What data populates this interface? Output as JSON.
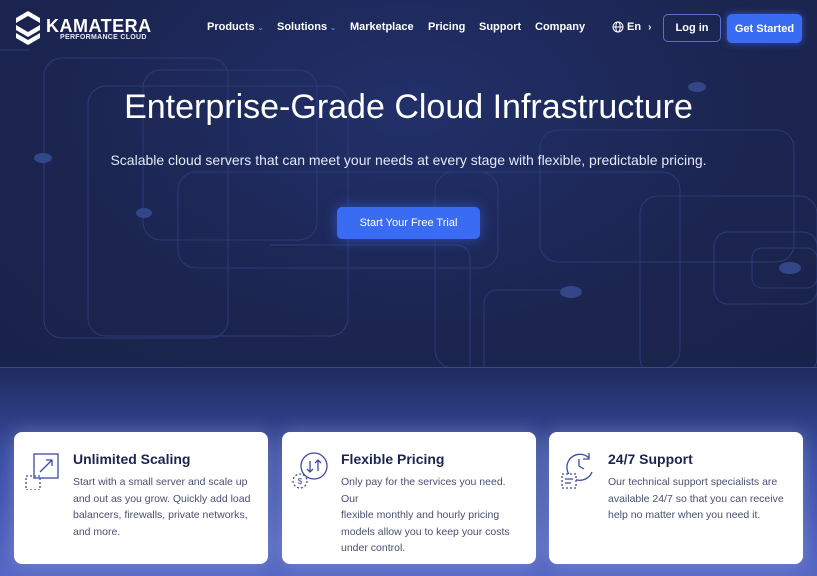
{
  "header": {
    "logo": {
      "name": "KAMATERA",
      "tagline": "PERFORMANCE CLOUD"
    },
    "nav": [
      {
        "label": "Products",
        "has_dropdown": true
      },
      {
        "label": "Solutions",
        "has_dropdown": true
      },
      {
        "label": "Marketplace",
        "has_dropdown": false
      },
      {
        "label": "Pricing",
        "has_dropdown": false
      },
      {
        "label": "Support",
        "has_dropdown": false
      },
      {
        "label": "Company",
        "has_dropdown": false
      }
    ],
    "language": {
      "label": "En",
      "icon": "globe-icon"
    },
    "login_label": "Log in",
    "get_started_label": "Get Started"
  },
  "hero": {
    "title": "Enterprise-Grade Cloud Infrastructure",
    "subtitle": "Scalable cloud servers that can meet your needs at every stage with flexible, predictable pricing.",
    "cta_label": "Start Your Free Trial"
  },
  "features": [
    {
      "icon": "scaling-icon",
      "title": "Unlimited Scaling",
      "lines": [
        "Start with a small server and scale up",
        "and out as you grow. Quickly add load",
        "balancers, firewalls, private networks,",
        "and more."
      ]
    },
    {
      "icon": "pricing-icon",
      "title": "Flexible Pricing",
      "lines": [
        "Only pay for the services you need. Our",
        "flexible monthly and hourly pricing",
        "models allow you to keep your costs",
        "under control."
      ]
    },
    {
      "icon": "support-icon",
      "title": "24/7 Support",
      "lines": [
        "Our technical support specialists are",
        "available 24/7 so that you can receive",
        "help no matter when you need it."
      ]
    }
  ],
  "colors": {
    "background": "#1c2852",
    "accent": "#3a6cf3",
    "card_title": "#1b2550",
    "icon_stroke": "#3a4aa0"
  }
}
